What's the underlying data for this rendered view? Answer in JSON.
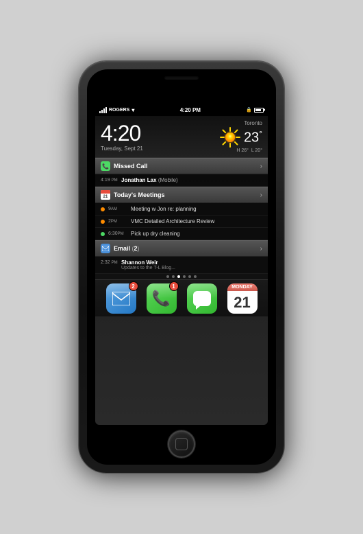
{
  "status_bar": {
    "carrier": "ROGERS",
    "wifi": "WiFi",
    "time": "4:20 PM",
    "lock_icon": "🔒",
    "battery": "80%"
  },
  "clock": {
    "time": "4:20",
    "date": "Tuesday, Sept 21"
  },
  "weather": {
    "city": "Toronto",
    "temperature": "23",
    "degree_symbol": "°",
    "high": "H 26°",
    "low": "L 20°"
  },
  "missed_call": {
    "section_title": "Missed Call",
    "time": "4:19",
    "ampm": "PM",
    "caller": "Jonathan Lax",
    "caller_type": "(Mobile)"
  },
  "meetings": {
    "section_title": "Today's Meetings",
    "cal_day": "21",
    "items": [
      {
        "time": "9",
        "ampm": "AM",
        "title": "Meeting w Jon re: planning",
        "dot_color": "#ff8c00"
      },
      {
        "time": "2",
        "ampm": "PM",
        "title": "VMC Detailed Architecture Review",
        "dot_color": "#ff8c00"
      },
      {
        "time": "6:30",
        "ampm": "PM",
        "title": "Pick up dry cleaning",
        "dot_color": "#4cd964"
      }
    ]
  },
  "email": {
    "section_title": "Email",
    "count": "2",
    "time": "2:32",
    "ampm": "PM",
    "sender": "Shannon Weir",
    "preview": "Updates to the T-L Blog..."
  },
  "dock": {
    "apps": [
      {
        "name": "Mail",
        "badge": "2",
        "type": "mail"
      },
      {
        "name": "Phone",
        "badge": "1",
        "type": "phone"
      },
      {
        "name": "Messages",
        "badge": null,
        "type": "messages"
      },
      {
        "name": "Calendar",
        "badge": null,
        "type": "calendar",
        "day": "21",
        "month": "Monday"
      }
    ],
    "dots": [
      false,
      false,
      true,
      false,
      false,
      false
    ]
  }
}
